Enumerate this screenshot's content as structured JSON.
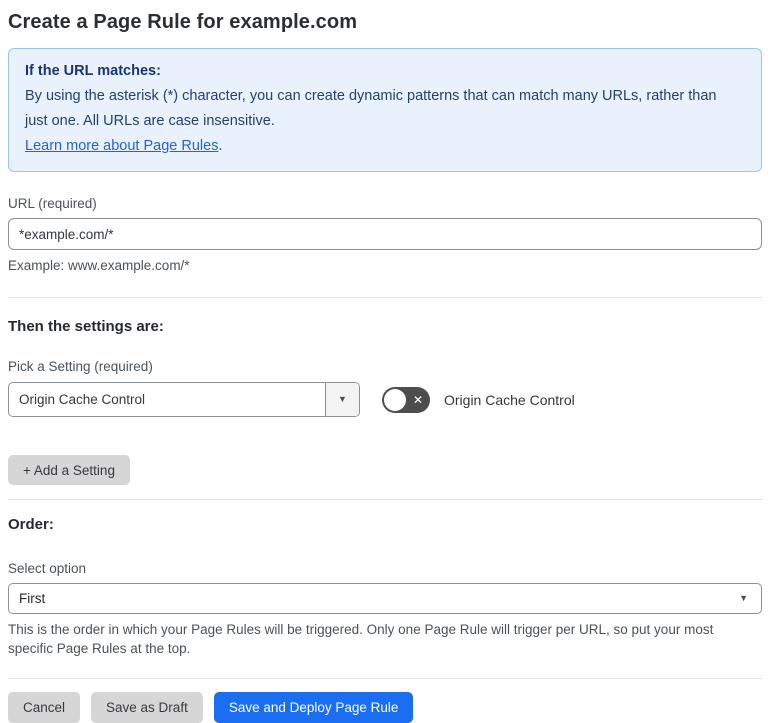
{
  "page": {
    "title": "Create a Page Rule for example.com"
  },
  "info_box": {
    "heading": "If the URL matches:",
    "body": "By using the asterisk (*) character, you can create dynamic patterns that can match many URLs, rather than just one. All URLs are case insensitive.",
    "link_label": "Learn more about Page Rules",
    "link_suffix": "."
  },
  "url_field": {
    "label": "URL (required)",
    "value": "*example.com/*",
    "example": "Example: www.example.com/*"
  },
  "settings_section": {
    "heading": "Then the settings are:",
    "picker_label": "Pick a Setting (required)",
    "picker_value": "Origin Cache Control",
    "dropdown_caret": "▼",
    "toggle_state": "off",
    "toggle_off_icon": "✕",
    "toggle_label": "Origin Cache Control",
    "add_setting_label": "+ Add a Setting"
  },
  "order_section": {
    "heading": "Order:",
    "select_label": "Select option",
    "select_value": "First",
    "select_caret": "▼",
    "help_text": "This is the order in which your Page Rules will be triggered. Only one Page Rule will trigger per URL, so put your most specific Page Rules at the top."
  },
  "actions": {
    "cancel": "Cancel",
    "save_draft": "Save as Draft",
    "save_deploy": "Save and Deploy Page Rule"
  },
  "colors": {
    "accent_blue": "#1a6ef2",
    "info_box_bg": "#e9f2fc",
    "info_box_border": "#9cc3e8",
    "info_text": "#24406f",
    "link_blue": "#2563c9",
    "toggle_bg": "#4d4d4d",
    "gray_button_bg": "#d6d6d6"
  }
}
